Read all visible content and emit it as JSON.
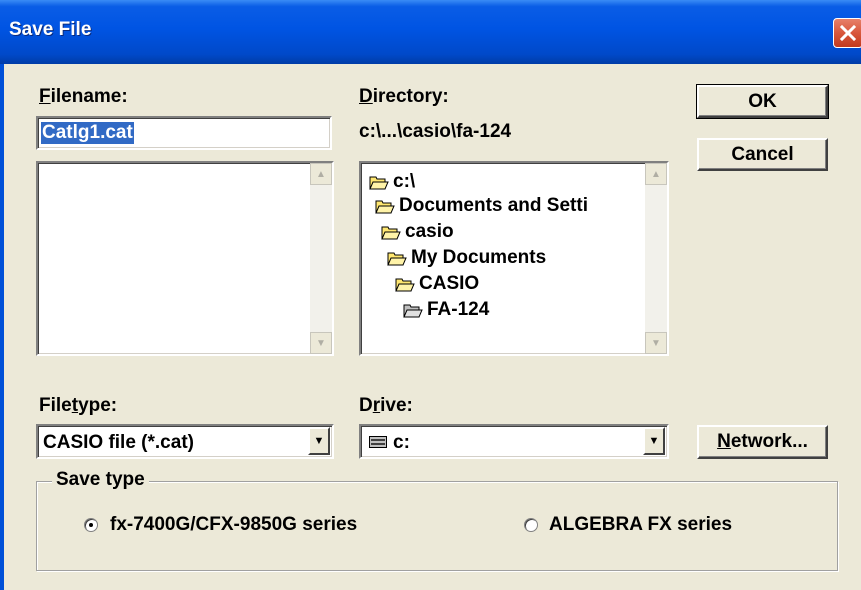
{
  "window": {
    "title": "Save File"
  },
  "filename": {
    "label_pre": "",
    "label_key": "F",
    "label_post": "ilename:",
    "value": "Catlg1.cat"
  },
  "directory": {
    "label_key": "D",
    "label_post": "irectory:",
    "path": "c:\\...\\casio\\fa-124",
    "tree": [
      {
        "label": "c:\\",
        "open": true
      },
      {
        "label": "Documents and Setti",
        "open": true
      },
      {
        "label": "casio",
        "open": true
      },
      {
        "label": "My Documents",
        "open": true
      },
      {
        "label": "CASIO",
        "open": true
      },
      {
        "label": "FA-124",
        "open": true
      }
    ]
  },
  "buttons": {
    "ok": "OK",
    "cancel": "Cancel",
    "network_key": "N",
    "network_post": "etwork..."
  },
  "filetype": {
    "label_pre": "File",
    "label_key": "t",
    "label_post": "ype:",
    "value": "CASIO file (*.cat)"
  },
  "drive": {
    "label_pre": "D",
    "label_key": "r",
    "label_post": "ive:",
    "value": "c:"
  },
  "save_type": {
    "legend": "Save type",
    "options": [
      {
        "label": "fx-7400G/CFX-9850G series",
        "selected": true
      },
      {
        "label": "ALGEBRA FX series",
        "selected": false
      }
    ]
  },
  "colors": {
    "title_bar": "#0054e3",
    "dialog_bg": "#ece9d8",
    "selection": "#316ac5",
    "folder_yellow": "#ffe770"
  },
  "icons": [
    "close-icon",
    "folder-open-icon",
    "drive-icon",
    "chevron-up-icon",
    "chevron-down-icon",
    "dropdown-arrow-icon"
  ]
}
